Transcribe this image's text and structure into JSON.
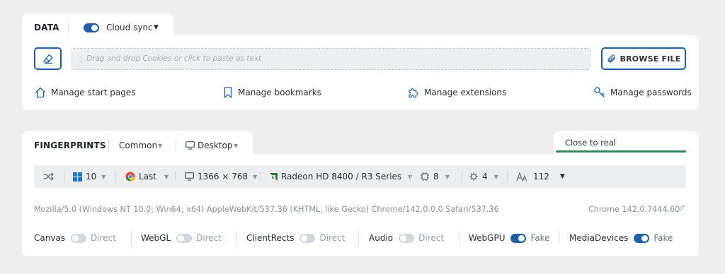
{
  "data_section": {
    "title": "DATA",
    "cloud_sync": {
      "label": "Cloud sync",
      "enabled": true
    },
    "dropzone_placeholder": "Drag and drop Cookies or click to paste as text",
    "browse_label": "BROWSE FILE",
    "links": [
      {
        "label": "Manage start pages",
        "icon": "home-icon"
      },
      {
        "label": "Manage bookmarks",
        "icon": "bookmark-icon"
      },
      {
        "label": "Manage extensions",
        "icon": "puzzle-icon"
      },
      {
        "label": "Manage passwords",
        "icon": "key-icon"
      }
    ]
  },
  "fingerprints": {
    "title": "FINGERPRINTS",
    "common_label": "Common",
    "device_label": "Desktop",
    "close_to_real_label": "Close to real",
    "close_to_real_value": 1.0,
    "bar": {
      "os_version": "10",
      "browser_version": "Last",
      "resolution": "1366 × 768",
      "gpu": "Radeon HD 8400 / R3 Series",
      "cpu_cores": "8",
      "memory": "4",
      "fonts_count": "112"
    },
    "user_agent": "Mozilla/5.0 (Windows NT 10.0; Win64; x64) AppleWebKit/537.36 (KHTML, like Gecko) Chrome/142.0.0.0 Safari/537.36",
    "chrome_version": "Chrome 142.0.7444.60",
    "permissions": [
      {
        "name": "Canvas",
        "mode": "Direct",
        "enabled": false
      },
      {
        "name": "WebGL",
        "mode": "Direct",
        "enabled": false
      },
      {
        "name": "ClientRects",
        "mode": "Direct",
        "enabled": false
      },
      {
        "name": "Audio",
        "mode": "Direct",
        "enabled": false
      },
      {
        "name": "WebGPU",
        "mode": "Fake",
        "enabled": true
      },
      {
        "name": "MediaDevices",
        "mode": "Fake",
        "enabled": true
      }
    ]
  },
  "colors": {
    "accent": "#1e5fa6",
    "background": "#eeeeee",
    "card": "#ffffff",
    "bar": "#ebedef"
  }
}
